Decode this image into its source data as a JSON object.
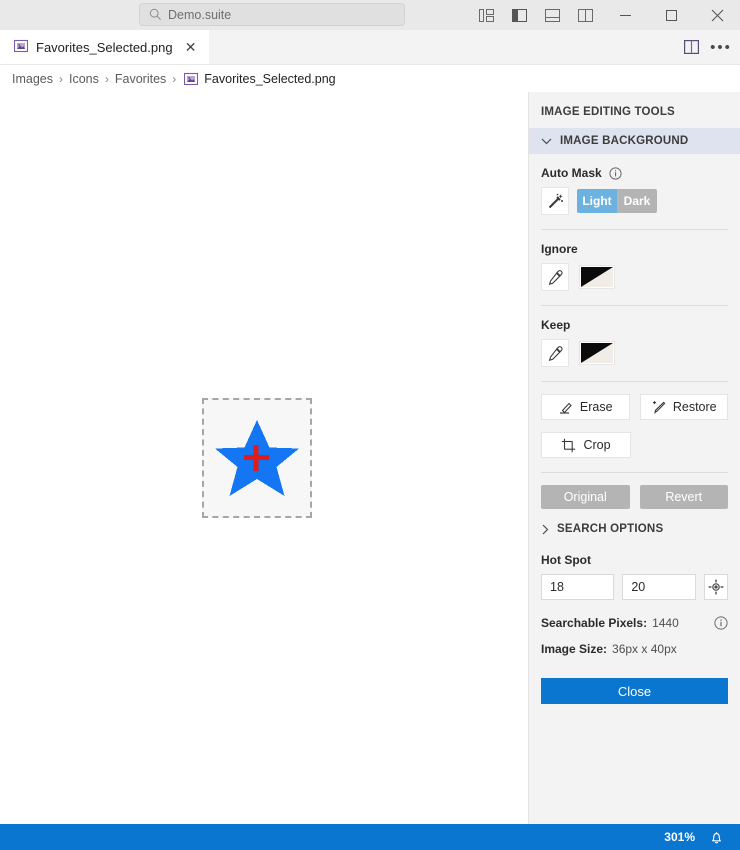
{
  "titlebar": {
    "search": {
      "value": "Demo.suite",
      "icon": "search-icon"
    },
    "layout_icons": [
      "panel-layout-icon",
      "panel-left-icon",
      "panel-bottom-icon",
      "panel-split-icon"
    ],
    "minimize": "—",
    "maximize": "□",
    "close": "✕"
  },
  "tabbar": {
    "active_tab": {
      "label": "Favorites_Selected.png",
      "icon": "image-file-icon",
      "close": "✕"
    },
    "split_view_icon": "split-view-icon",
    "more_label": "•••"
  },
  "breadcrumb": {
    "items": [
      "Images",
      "Icons",
      "Favorites"
    ],
    "separator": "›",
    "current": "Favorites_Selected.png",
    "current_icon": "image-file-icon"
  },
  "canvas": {
    "image_alt": "blue-star-icon",
    "hotspot_marker": "red-crosshair"
  },
  "panel": {
    "title": "IMAGE EDITING TOOLS",
    "sections": {
      "image_background": {
        "label": "IMAGE BACKGROUND",
        "expanded": true
      },
      "search_options": {
        "label": "SEARCH OPTIONS",
        "expanded": false
      }
    },
    "auto_mask": {
      "label": "Auto Mask",
      "info_icon": "info-icon",
      "wand_icon": "magic-wand-icon",
      "options": [
        "Light",
        "Dark"
      ],
      "selected": "Light"
    },
    "ignore": {
      "label": "Ignore",
      "picker_icon": "eyedropper-icon",
      "swatch_icon": "black-white-swatch"
    },
    "keep": {
      "label": "Keep",
      "picker_icon": "eyedropper-icon",
      "swatch_icon": "black-white-swatch"
    },
    "actions": {
      "erase": "Erase",
      "restore": "Restore",
      "crop": "Crop",
      "original": "Original",
      "revert": "Revert"
    },
    "hot_spot": {
      "label": "Hot Spot",
      "x": "18",
      "y": "20",
      "target_icon": "crosshair-target-icon"
    },
    "searchable_pixels": {
      "label": "Searchable Pixels:",
      "value": "1440",
      "info_icon": "info-icon"
    },
    "image_size": {
      "label": "Image Size:",
      "value": "36px x 40px"
    },
    "close_button": "Close"
  },
  "statusbar": {
    "zoom": "301%",
    "bell_icon": "notification-bell-icon"
  },
  "colors": {
    "accent": "#0b76cf",
    "toggle_on": "#6cb2e0",
    "toggle_off": "#b4b4b4",
    "section_header": "#dfe3ef",
    "star": "#1476f2",
    "hotspot": "#e01b1b"
  }
}
